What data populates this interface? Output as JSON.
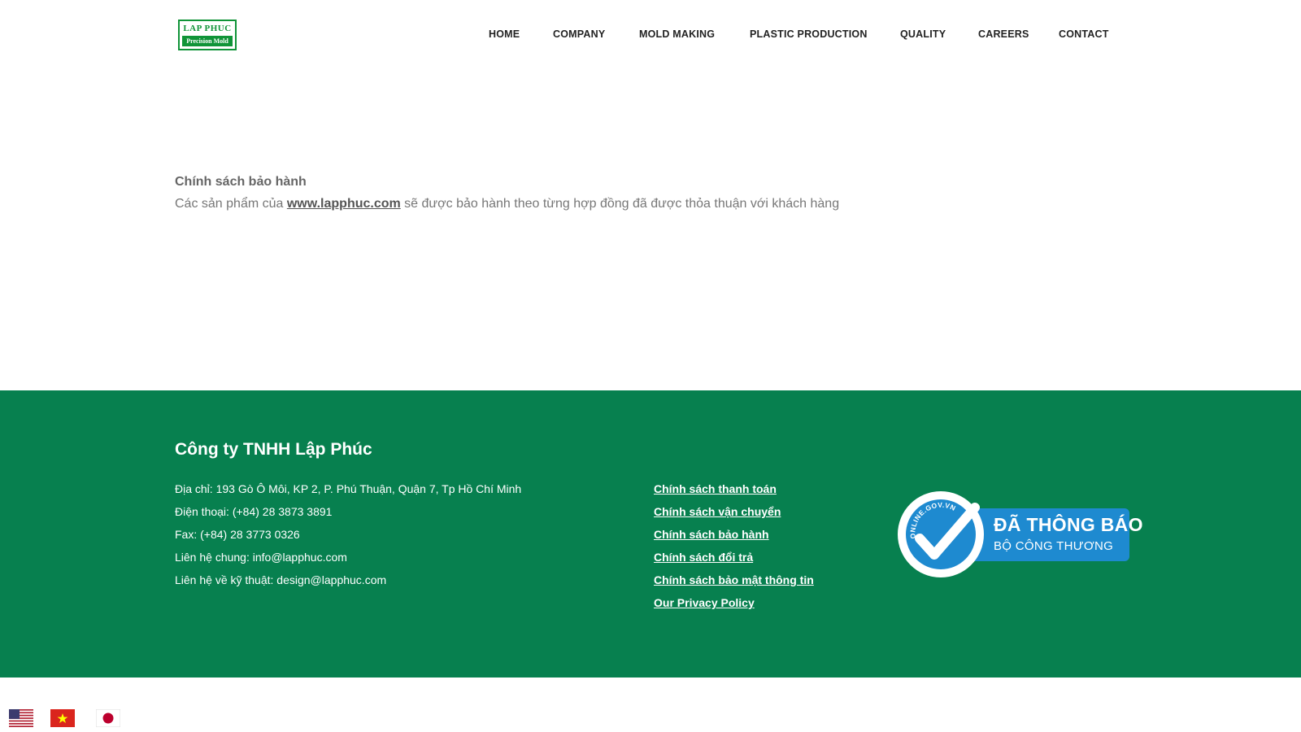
{
  "header": {
    "logo": {
      "line1": "LAP PHUC",
      "line2": "Precision Mold"
    },
    "nav": [
      {
        "label": "HOME"
      },
      {
        "label": "COMPANY"
      },
      {
        "label": "MOLD MAKING"
      },
      {
        "label": "PLASTIC PRODUCTION"
      },
      {
        "label": "QUALITY"
      },
      {
        "label": "CAREERS"
      },
      {
        "label": "CONTACT"
      }
    ]
  },
  "main": {
    "title": "Chính sách bảo hành",
    "text_before": "Các sản phẩm của ",
    "link": "www.lapphuc.com",
    "text_after": " sẽ được bảo hành theo từng hợp đồng đã được thỏa thuận với khách hàng"
  },
  "footer": {
    "company_name": "Công ty TNHH Lập Phúc",
    "info": [
      "Địa chỉ: 193 Gò Ô Môi, KP 2, P. Phú Thuận, Quận 7, Tp Hồ Chí Minh",
      "Điện thoại: (+84) 28 3873 3891",
      "Fax: (+84) 28 3773 0326",
      "Liên hệ chung: info@lapphuc.com",
      "Liên hệ về kỹ thuật: design@lapphuc.com"
    ],
    "policy_links": [
      "Chính sách thanh toán",
      "Chính sách vận chuyển",
      "Chính sách bảo hành",
      "Chính sách đổi trả",
      "Chính sách bảo mật thông tin",
      "Our Privacy Policy"
    ],
    "badge": {
      "line1": "ĐÃ THÔNG BÁO",
      "line2": "BỘ CÔNG THƯƠNG",
      "arc_text": "ONLINE.GOV.VN"
    }
  },
  "languages": [
    {
      "icon": "us-flag-icon"
    },
    {
      "icon": "vietnam-flag-icon"
    },
    {
      "icon": "japan-flag-icon"
    }
  ],
  "colors": {
    "brand_green": "#07804f",
    "logo_green": "#109438",
    "badge_blue": "#1e8ad0"
  }
}
